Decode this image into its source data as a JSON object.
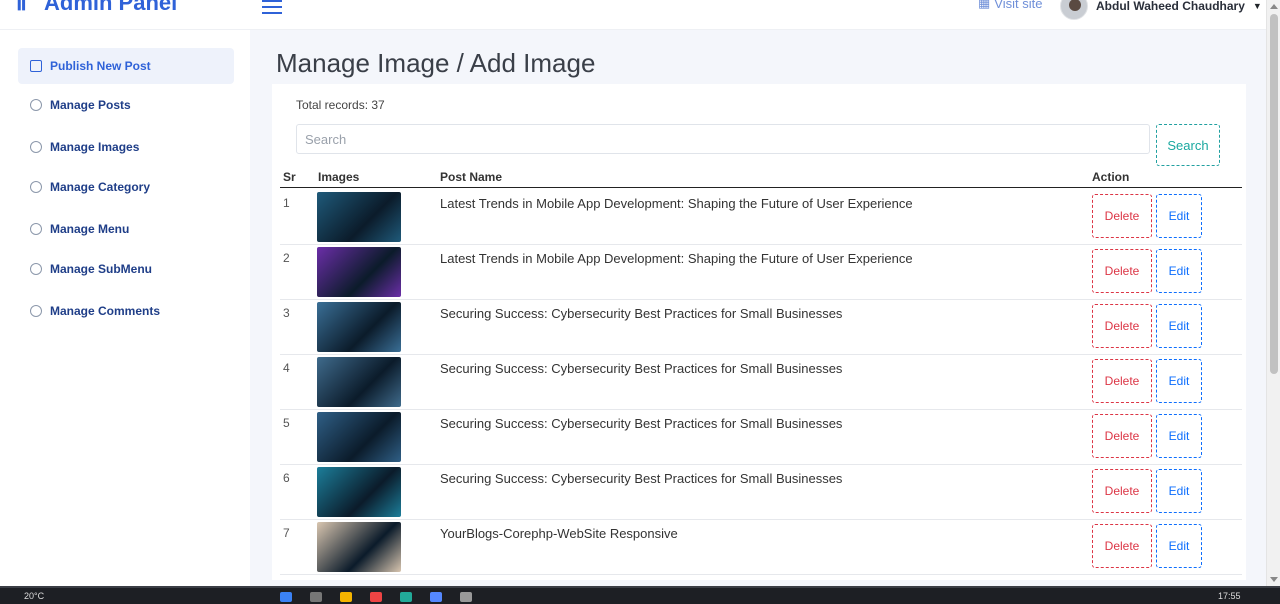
{
  "header": {
    "brand": "Admin Panel",
    "visit_site": "Visit site",
    "user_name": "Abdul Waheed Chaudhary"
  },
  "sidebar": {
    "items": [
      {
        "label": "Publish New Post"
      },
      {
        "label": "Manage Posts"
      },
      {
        "label": "Manage Images"
      },
      {
        "label": "Manage Category"
      },
      {
        "label": "Manage Menu"
      },
      {
        "label": "Manage SubMenu"
      },
      {
        "label": "Manage Comments"
      }
    ]
  },
  "main": {
    "title": "Manage Image / Add Image",
    "total_records": "Total records: 37",
    "search_placeholder": "Search",
    "search_button": "Search",
    "columns": {
      "sr": "Sr",
      "images": "Images",
      "post_name": "Post Name",
      "action": "Action"
    },
    "delete_label": "Delete",
    "edit_label": "Edit",
    "rows": [
      {
        "sr": "1",
        "name": "Latest Trends in Mobile App Development: Shaping the Future of User Experience",
        "thumb_color": "#1f5a7a"
      },
      {
        "sr": "2",
        "name": "Latest Trends in Mobile App Development: Shaping the Future of User Experience",
        "thumb_color": "#6b2ea8"
      },
      {
        "sr": "3",
        "name": "Securing Success: Cybersecurity Best Practices for Small Businesses",
        "thumb_color": "#3a6f96"
      },
      {
        "sr": "4",
        "name": "Securing Success: Cybersecurity Best Practices for Small Businesses",
        "thumb_color": "#3f6b8c"
      },
      {
        "sr": "5",
        "name": "Securing Success: Cybersecurity Best Practices for Small Businesses",
        "thumb_color": "#2f5f86"
      },
      {
        "sr": "6",
        "name": "Securing Success: Cybersecurity Best Practices for Small Businesses",
        "thumb_color": "#1c7e9a"
      },
      {
        "sr": "7",
        "name": "YourBlogs-Corephp-WebSite Responsive",
        "thumb_color": "#d9c6b0"
      }
    ]
  },
  "taskbar": {
    "weather": "20°C",
    "time": "17:55"
  },
  "colors": {
    "accent": "#2f62d8",
    "delete": "#dc3545",
    "edit": "#0d6efd",
    "search": "#1aa8a0"
  }
}
